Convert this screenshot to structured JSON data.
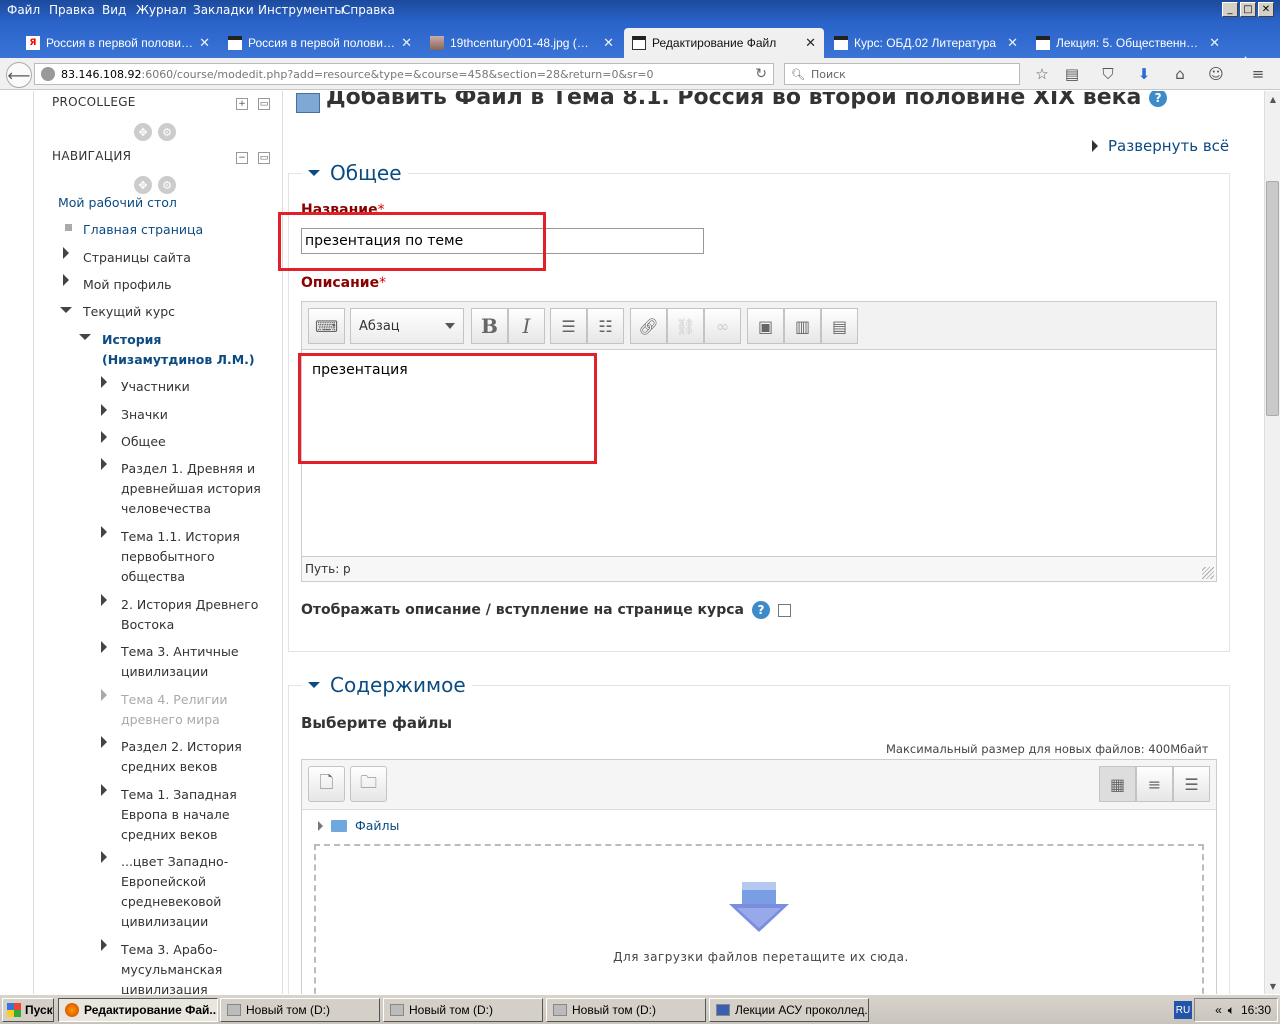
{
  "menu": [
    "Файл",
    "Правка",
    "Вид",
    "Журнал",
    "Закладки",
    "Инструменты",
    "Справка"
  ],
  "tabs": [
    {
      "label": "Россия в первой половине...",
      "icon": "yandex-icon"
    },
    {
      "label": "Россия в первой половине...",
      "icon": "moodle-icon"
    },
    {
      "label": "19thcentury001-48.jpg (Из...",
      "icon": "image-icon"
    },
    {
      "label": "Редактирование Файл",
      "icon": "moodle-icon",
      "active": true
    },
    {
      "label": "Курс: ОБД.02 Литература",
      "icon": "moodle-icon"
    },
    {
      "label": "Лекция: 5. Общественная...",
      "icon": "moodle-icon"
    }
  ],
  "address": {
    "host": "83.146.108.92",
    "path": ":6060/course/modedit.php?add=resource&type=&course=458&section=28&return=0&sr=0"
  },
  "search": {
    "placeholder": "Поиск"
  },
  "sidebar": {
    "block1_title": "PROCOLLEGE",
    "block2_title": "НАВИГАЦИЯ",
    "items": {
      "dashboard": "Мой рабочий стол",
      "home": "Главная страница",
      "site_pages": "Страницы сайта",
      "profile": "Мой профиль",
      "current_course": "Текущий курс",
      "course_l1": "История",
      "course_l2": "(Низамутдинов Л.М.)",
      "participants": "Участники",
      "badges": "Значки",
      "general": "Общее",
      "s1": [
        "Раздел 1. Древняя и",
        "древнейшая история",
        "человечества"
      ],
      "s2": [
        "Тема 1.1. История",
        "первобытного",
        "общества"
      ],
      "s3": [
        "2. История Древнего",
        "Востока"
      ],
      "s4": [
        "Тема 3. Античные",
        "цивилизации"
      ],
      "s5": [
        "Тема 4. Религии",
        "древнего мира"
      ],
      "s6": [
        "Раздел 2. История",
        "средних веков"
      ],
      "s7": [
        "Тема 1. Западная",
        "Европа в начале",
        "средних веков"
      ],
      "s8": [
        "...цвет Западно-",
        "Европейской",
        "средневековой",
        "цивилизации"
      ],
      "s9": [
        "Тема 3. Арабо-",
        "мусульманская",
        "цивилизация"
      ]
    }
  },
  "main": {
    "title": "Добавить Файл в Тема 8.1. Россия во второй половине XIX века",
    "expand_all": "Развернуть всё",
    "general_legend": "Общее",
    "name_label": "Название",
    "name_value": "презентация по теме",
    "desc_label": "Описание",
    "format_select": "Абзац",
    "editor_text": "презентация",
    "path_label": "Путь: p",
    "show_desc_label": "Отображать описание / вступление на странице курса",
    "show_desc_checked": false,
    "content_legend": "Содержимое",
    "select_files_label": "Выберите файлы",
    "max_size": "Максимальный размер для новых файлов: 400Мбайт",
    "folder_label": "Файлы",
    "drop_text": "Для загрузки файлов перетащите их сюда."
  },
  "annotation_color": "#e2202a",
  "taskbar": {
    "start": "Пуск",
    "items": [
      "Редактирование Фай...",
      "Новый том (D:)",
      "Новый том (D:)",
      "Новый том (D:)",
      "Лекции АСУ проколлед..."
    ],
    "lang": "RU",
    "clock": "16:30"
  }
}
